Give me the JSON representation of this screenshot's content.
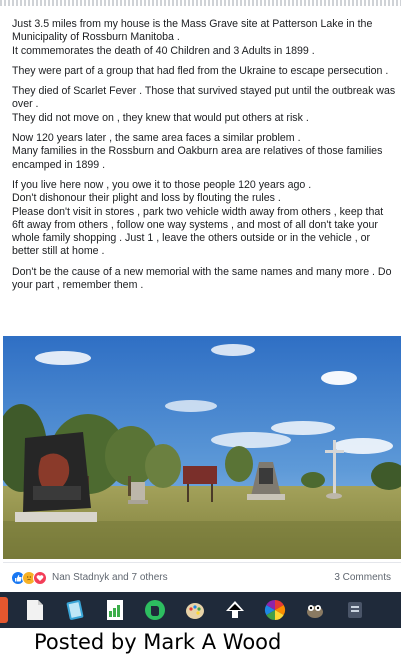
{
  "post": {
    "paragraphs": [
      "Just 3.5 miles from my house is the Mass Grave site at Patterson Lake in the Municipality of Rossburn Manitoba .\nIt commemorates the death of 40 Children and 3 Adults in 1899 .",
      "They were part of a group that had fled from the Ukraine to escape persecution .",
      "They died of Scarlet Fever . Those that survived stayed put until the outbreak was over .\nThey did not move on , they knew that would put others at risk .",
      "Now 120 years later , the same area faces a similar problem .\nMany families in the Rossburn and Oakburn area are relatives of those families encamped in 1899 .",
      "If you live here now , you owe it to those people 120 years ago .\nDon't dishonour their plight and loss by flouting the rules .\nPlease don't visit in stores , park two vehicle width away from others , keep that 6ft away from others , follow one way systems , and most of all don't take your whole family shopping . Just 1 , leave the others outside or in the vehicle , or better still at home .",
      "Don't be the cause of a new memorial with the same names and many more . Do your part , remember them ."
    ]
  },
  "reactions": {
    "icons": [
      "like-icon",
      "sad-icon",
      "love-icon"
    ],
    "names": "Nan Stadnyk and 7 others",
    "comments": "3 Comments"
  },
  "taskbar": {
    "icons": [
      "app-icon",
      "file-icon",
      "notebook-icon",
      "spreadsheet-icon",
      "evernote-icon",
      "paint-palette-icon",
      "inkscape-icon",
      "color-wheel-icon",
      "gimp-icon",
      "extra-app-icon"
    ]
  },
  "caption": "Posted  by Mark A Wood"
}
